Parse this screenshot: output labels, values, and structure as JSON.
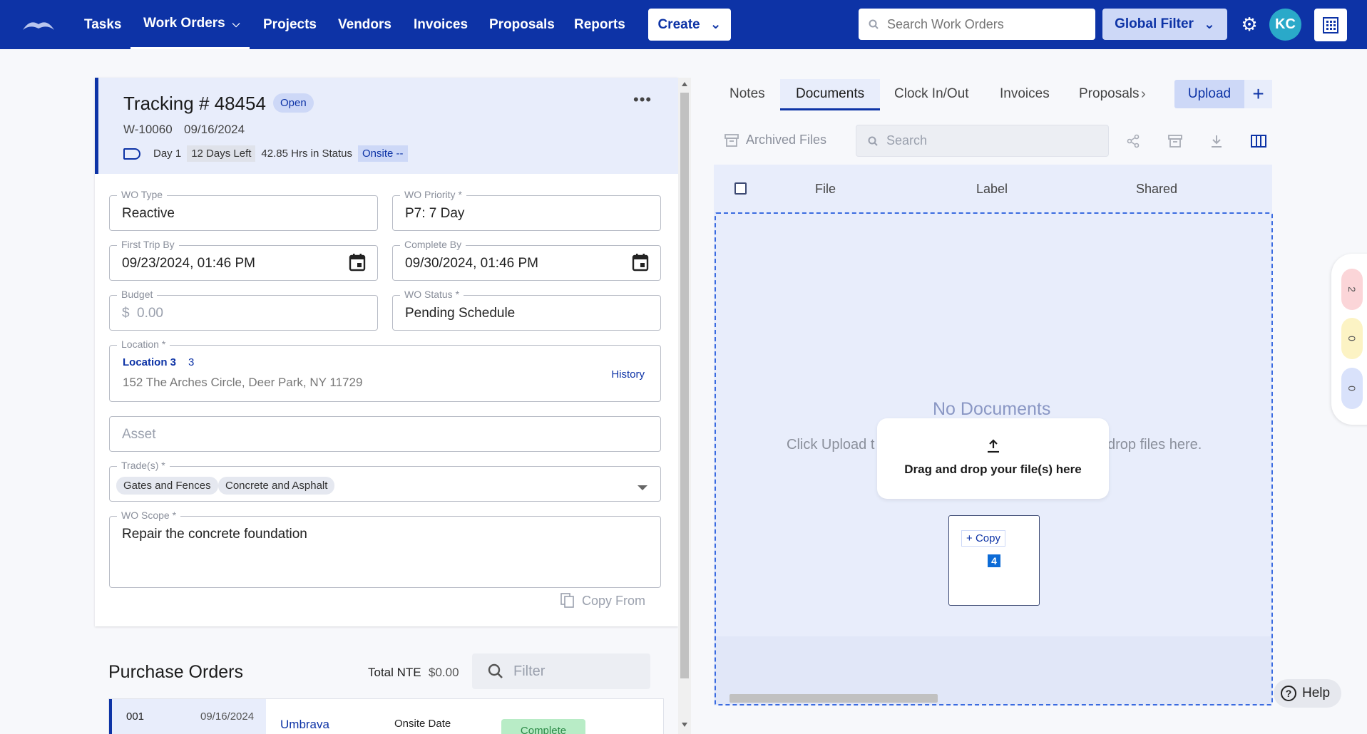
{
  "nav": {
    "items": [
      "Tasks",
      "Work Orders",
      "Projects",
      "Vendors",
      "Invoices",
      "Proposals",
      "Reports"
    ],
    "create_label": "Create",
    "search_placeholder": "Search Work Orders",
    "global_filter_label": "Global Filter",
    "avatar_initials": "KC",
    "brand_color": "#0d33a6"
  },
  "wo": {
    "tracking_title": "Tracking # 48454",
    "status": "Open",
    "wo_number": "W-10060",
    "created_date": "09/16/2024",
    "day": "Day 1",
    "days_left": "12 Days Left",
    "hrs_in_status": "42.85 Hrs in Status",
    "onsite": "Onsite --"
  },
  "form": {
    "wo_type_label": "WO Type",
    "wo_type_value": "Reactive",
    "wo_priority_label": "WO Priority *",
    "wo_priority_value": "P7: 7 Day",
    "first_trip_label": "First Trip By",
    "first_trip_value": "09/23/2024, 01:46 PM",
    "complete_by_label": "Complete By",
    "complete_by_value": "09/30/2024, 01:46 PM",
    "budget_label": "Budget",
    "budget_currency": "$",
    "budget_placeholder": "0.00",
    "wo_status_label": "WO Status *",
    "wo_status_value": "Pending Schedule",
    "location_label": "Location *",
    "location_name": "Location 3",
    "location_num": "3",
    "location_address": "152 The Arches Circle, Deer Park, NY 11729",
    "history_label": "History",
    "asset_placeholder": "Asset",
    "trades_label": "Trade(s) *",
    "trades": [
      "Gates and Fences",
      "Concrete and Asphalt"
    ],
    "scope_label": "WO Scope *",
    "scope_value": "Repair the concrete foundation",
    "copy_from_label": "Copy From"
  },
  "purchase_orders": {
    "title": "Purchase Orders",
    "total_label": "Total NTE",
    "total_value": "$0.00",
    "filter_placeholder": "Filter",
    "rows": [
      {
        "id": "001",
        "date": "09/16/2024",
        "vendor": "Umbrava",
        "onsite_label": "Onsite Date",
        "status": "Complete"
      }
    ]
  },
  "documents": {
    "tabs": [
      "Notes",
      "Documents",
      "Clock In/Out",
      "Invoices",
      "Proposals"
    ],
    "active_tab": "Documents",
    "upload_label": "Upload",
    "archived_label": "Archived Files",
    "search_placeholder": "Search",
    "columns": [
      "File",
      "Label",
      "Shared"
    ],
    "empty_title": "No Documents",
    "empty_hint_left": "Click Upload t",
    "empty_hint_right": "drop files here.",
    "drag_text": "Drag and drop your file(s) here",
    "copy_label": "Copy",
    "copy_count": "4"
  },
  "side_counts": [
    {
      "value": "2",
      "color": "#fbd5d8"
    },
    {
      "value": "0",
      "color": "#fcf3c4"
    },
    {
      "value": "0",
      "color": "#d9e2fb"
    }
  ],
  "help_label": "Help"
}
